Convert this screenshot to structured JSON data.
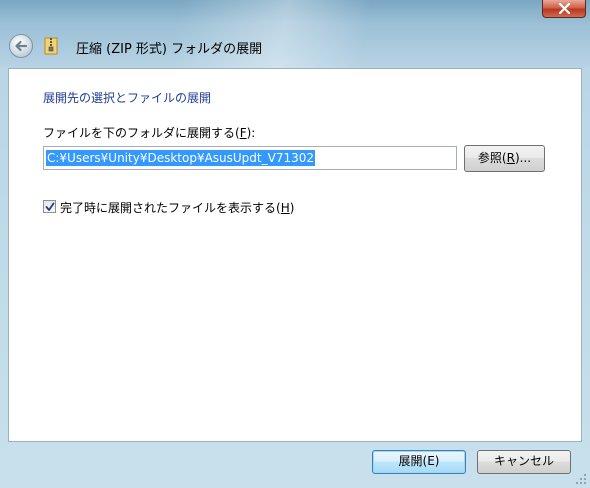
{
  "window": {
    "title": "圧縮 (ZIP 形式) フォルダの展開"
  },
  "content": {
    "section_heading": "展開先の選択とファイルの展開",
    "dest_label_prefix": "ファイルを下のフォルダに展開する(",
    "dest_label_accel": "F",
    "dest_label_suffix": "):",
    "path_value": "C:¥Users¥Unity¥Desktop¥AsusUpdt_V71302",
    "browse_prefix": "参照(",
    "browse_accel": "R",
    "browse_suffix": ")...",
    "show_files_checkbox": {
      "checked": true,
      "label_prefix": "完了時に展開されたファイルを表示する(",
      "label_accel": "H",
      "label_suffix": ")"
    }
  },
  "footer": {
    "extract_label": "展開(E)",
    "cancel_label": "キャンセル"
  },
  "icons": {
    "back": "back-arrow-icon",
    "zip": "zip-folder-icon",
    "close": "close-icon"
  }
}
